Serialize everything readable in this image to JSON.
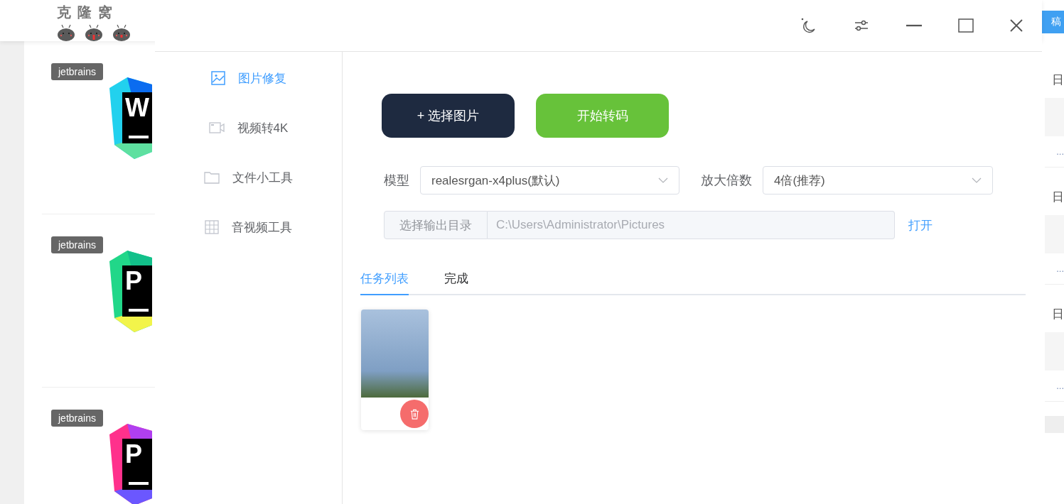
{
  "site": {
    "logo": {
      "text": "克 隆 窝"
    },
    "contribute_button": "稿",
    "cards": [
      {
        "tag": "jetbrains",
        "kind": "blue",
        "letters": "W"
      },
      {
        "tag": "jetbrains",
        "kind": "green",
        "letters": "P"
      },
      {
        "tag": "jetbrains",
        "kind": "pink",
        "letters": "P"
      }
    ],
    "side_items": [
      {
        "date": "日",
        "snippet": "..."
      },
      {
        "date": "日",
        "snippet": "..."
      },
      {
        "date": "日",
        "snippet": "..."
      }
    ]
  },
  "app": {
    "sidebar": {
      "items": [
        {
          "label": "图片修复",
          "kind": "image",
          "selected": true
        },
        {
          "label": "视频转4K",
          "kind": "video",
          "selected": false
        },
        {
          "label": "文件小工具",
          "kind": "folder",
          "selected": false
        },
        {
          "label": "音视频工具",
          "kind": "grid",
          "selected": false
        }
      ]
    },
    "select_button": "+ 选择图片",
    "start_button": "开始转码",
    "model": {
      "label": "模型",
      "value": "realesrgan-x4plus(默认)"
    },
    "scale": {
      "label": "放大倍数",
      "value": "4倍(推荐)"
    },
    "output": {
      "button": "选择输出目录",
      "value": "C:\\Users\\Administrator\\Pictures",
      "open_link": "打开"
    },
    "tabs": [
      {
        "label": "任务列表",
        "selected": true
      },
      {
        "label": "完成",
        "selected": false
      }
    ],
    "tasks": [
      {
        "kind": "image"
      }
    ]
  }
}
